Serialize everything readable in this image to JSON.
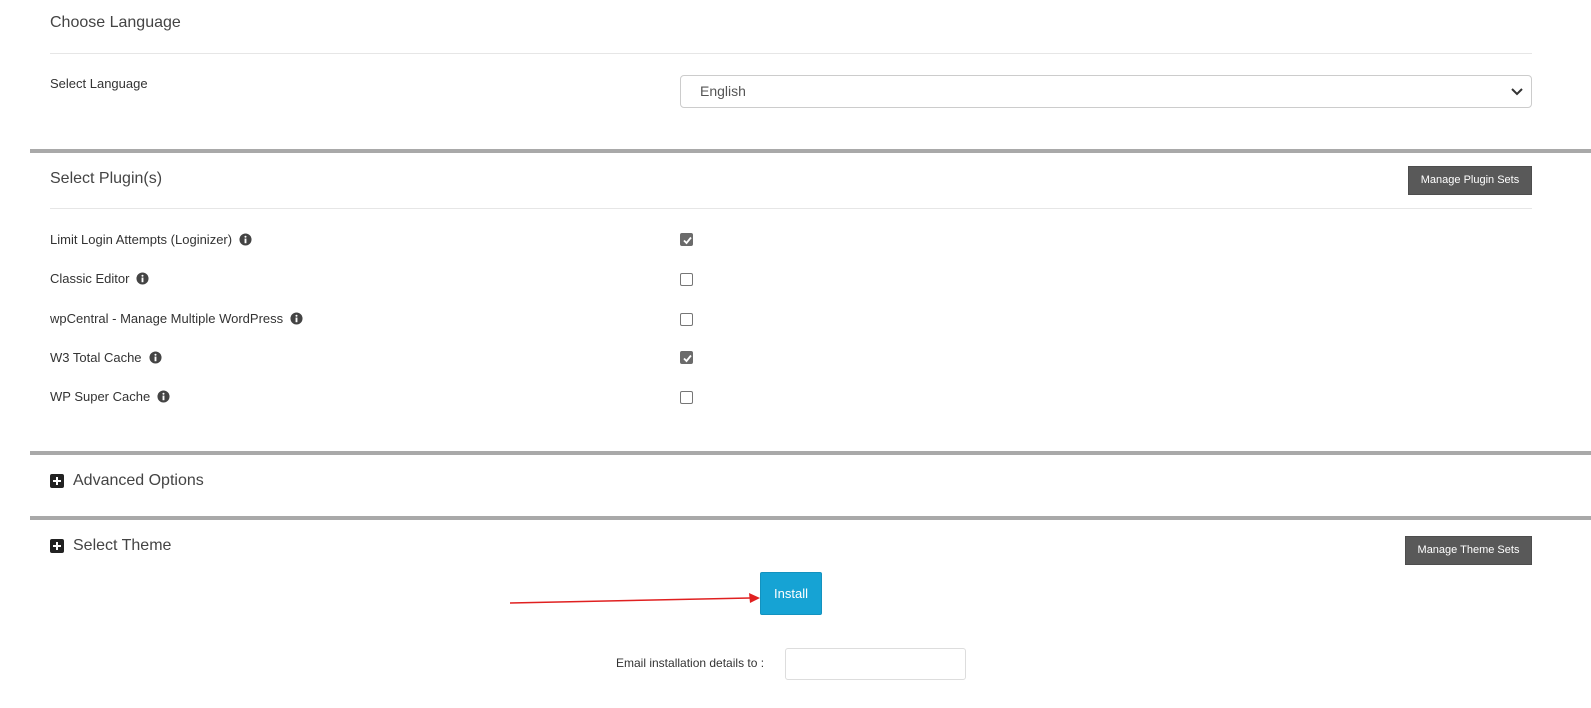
{
  "language_section": {
    "title": "Choose Language",
    "field_label": "Select Language",
    "selected_language": "English"
  },
  "plugins_section": {
    "title": "Select Plugin(s)",
    "manage_button": "Manage Plugin Sets",
    "plugins": [
      {
        "label": "Limit Login Attempts (Loginizer)",
        "checked": true
      },
      {
        "label": "Classic Editor",
        "checked": false
      },
      {
        "label": "wpCentral - Manage Multiple WordPress",
        "checked": false
      },
      {
        "label": "W3 Total Cache",
        "checked": true
      },
      {
        "label": "WP Super Cache",
        "checked": false
      }
    ]
  },
  "advanced_section": {
    "title": "Advanced Options"
  },
  "theme_section": {
    "title": "Select Theme",
    "manage_button": "Manage Theme Sets"
  },
  "install_button": "Install",
  "email": {
    "label": "Email installation details to :",
    "value": ""
  },
  "colors": {
    "install_blue": "#16a3d4",
    "dark_button": "#595959",
    "annotation_arrow": "#e02020"
  },
  "icons": {
    "info": "info-circle-icon",
    "expand": "plus-square-icon",
    "dropdown": "chevron-down-icon"
  }
}
